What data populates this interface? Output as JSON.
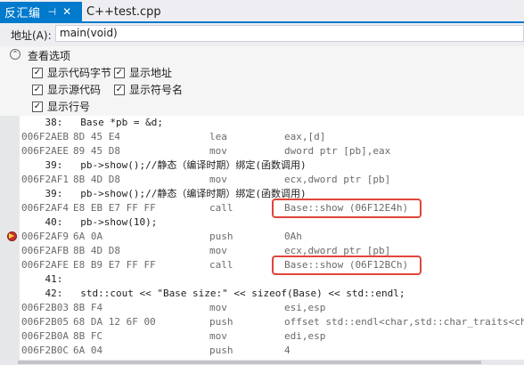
{
  "tabs": [
    {
      "label": "反汇编",
      "active": true
    },
    {
      "label": "C++test.cpp",
      "active": false
    }
  ],
  "tab_pin_glyph": "⊣",
  "tab_close_glyph": "✕",
  "address": {
    "label": "地址(A):",
    "value": "main(void)"
  },
  "options": {
    "title": "查看选项",
    "items": [
      {
        "label": "显示代码字节",
        "checked": true
      },
      {
        "label": "显示地址",
        "checked": true
      },
      {
        "label": "显示源代码",
        "checked": true
      },
      {
        "label": "显示符号名",
        "checked": true
      },
      {
        "label": "显示行号",
        "checked": true
      }
    ]
  },
  "code": {
    "lines": [
      {
        "kind": "src",
        "text": "    38:   Base *pb = &d;"
      },
      {
        "kind": "asm",
        "addr": "006F2AEB",
        "bytes": "8D 45 E4",
        "mn": "lea",
        "op": "eax,[d]"
      },
      {
        "kind": "asm",
        "addr": "006F2AEE",
        "bytes": "89 45 D8",
        "mn": "mov",
        "op": "dword ptr [pb],eax"
      },
      {
        "kind": "src",
        "text": "    39:   pb->show();//静态（编译时期）绑定(函数调用)"
      },
      {
        "kind": "asm",
        "addr": "006F2AF1",
        "bytes": "8B 4D D8",
        "mn": "mov",
        "op": "ecx,dword ptr [pb]"
      },
      {
        "kind": "src",
        "text": "    39:   pb->show();//静态（编译时期）绑定(函数调用)"
      },
      {
        "kind": "asm",
        "addr": "006F2AF4",
        "bytes": "E8 EB E7 FF FF",
        "mn": "call",
        "op": "Base::show (06F12E4h)"
      },
      {
        "kind": "src",
        "text": "    40:   pb->show(10);"
      },
      {
        "kind": "asm",
        "addr": "006F2AF9",
        "bytes": "6A 0A",
        "mn": "push",
        "op": "0Ah"
      },
      {
        "kind": "asm",
        "addr": "006F2AFB",
        "bytes": "8B 4D D8",
        "mn": "mov",
        "op": "ecx,dword ptr [pb]"
      },
      {
        "kind": "asm",
        "addr": "006F2AFE",
        "bytes": "E8 B9 E7 FF FF",
        "mn": "call",
        "op": "Base::show (06F12BCh)"
      },
      {
        "kind": "src",
        "text": "    41:"
      },
      {
        "kind": "src",
        "text": "    42:   std::cout << \"Base size:\" << sizeof(Base) << std::endl;"
      },
      {
        "kind": "asm",
        "addr": "006F2B03",
        "bytes": "8B F4",
        "mn": "mov",
        "op": "esi,esp"
      },
      {
        "kind": "asm",
        "addr": "006F2B05",
        "bytes": "68 DA 12 6F 00",
        "mn": "push",
        "op": "offset std::endl<char,std::char_traits<ch"
      },
      {
        "kind": "asm",
        "addr": "006F2B0A",
        "bytes": "8B FC",
        "mn": "mov",
        "op": "edi,esp"
      },
      {
        "kind": "asm",
        "addr": "006F2B0C",
        "bytes": "6A 04",
        "mn": "push",
        "op": "4"
      }
    ],
    "breakpoint_line": 8,
    "highlighted_lines": [
      6,
      10
    ]
  },
  "colors": {
    "accent": "#007acc",
    "highlight_box": "#e0453a",
    "breakpoint": "#c8302b"
  }
}
